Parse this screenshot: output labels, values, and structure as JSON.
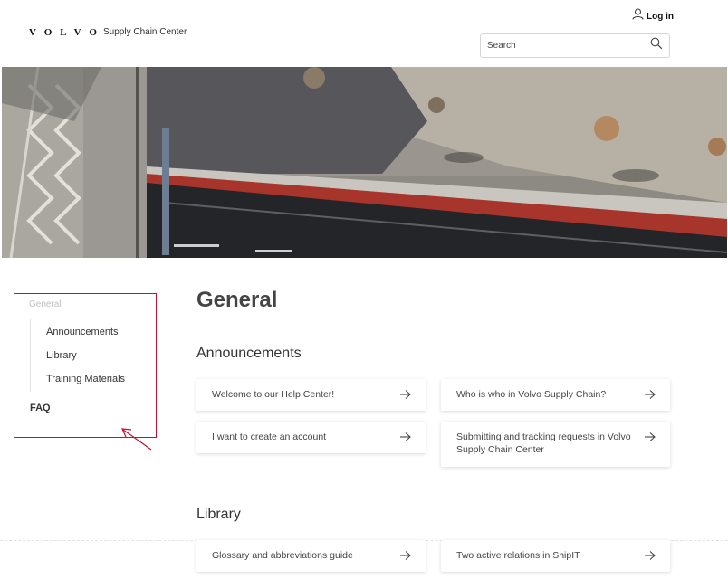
{
  "header": {
    "logo": "VOLVO",
    "site_name": "Supply Chain Center",
    "login_label": "Log in",
    "search_placeholder": "Search"
  },
  "sidebar": {
    "category": "General",
    "items": [
      "Announcements",
      "Library",
      "Training Materials"
    ],
    "faq": "FAQ"
  },
  "main": {
    "page_title": "General",
    "sections": [
      {
        "title": "Announcements",
        "articles": [
          "Welcome to our Help Center!",
          "Who is who in Volvo Supply Chain?",
          "I want to create an account",
          "Submitting and tracking requests in Volvo Supply Chain Center"
        ]
      },
      {
        "title": "Library",
        "articles": [
          "Glossary and abbreviations guide",
          "Two active relations in ShipIT"
        ]
      }
    ]
  },
  "colors": {
    "annotation_red": "#c8102e",
    "text_dark": "#333333"
  }
}
